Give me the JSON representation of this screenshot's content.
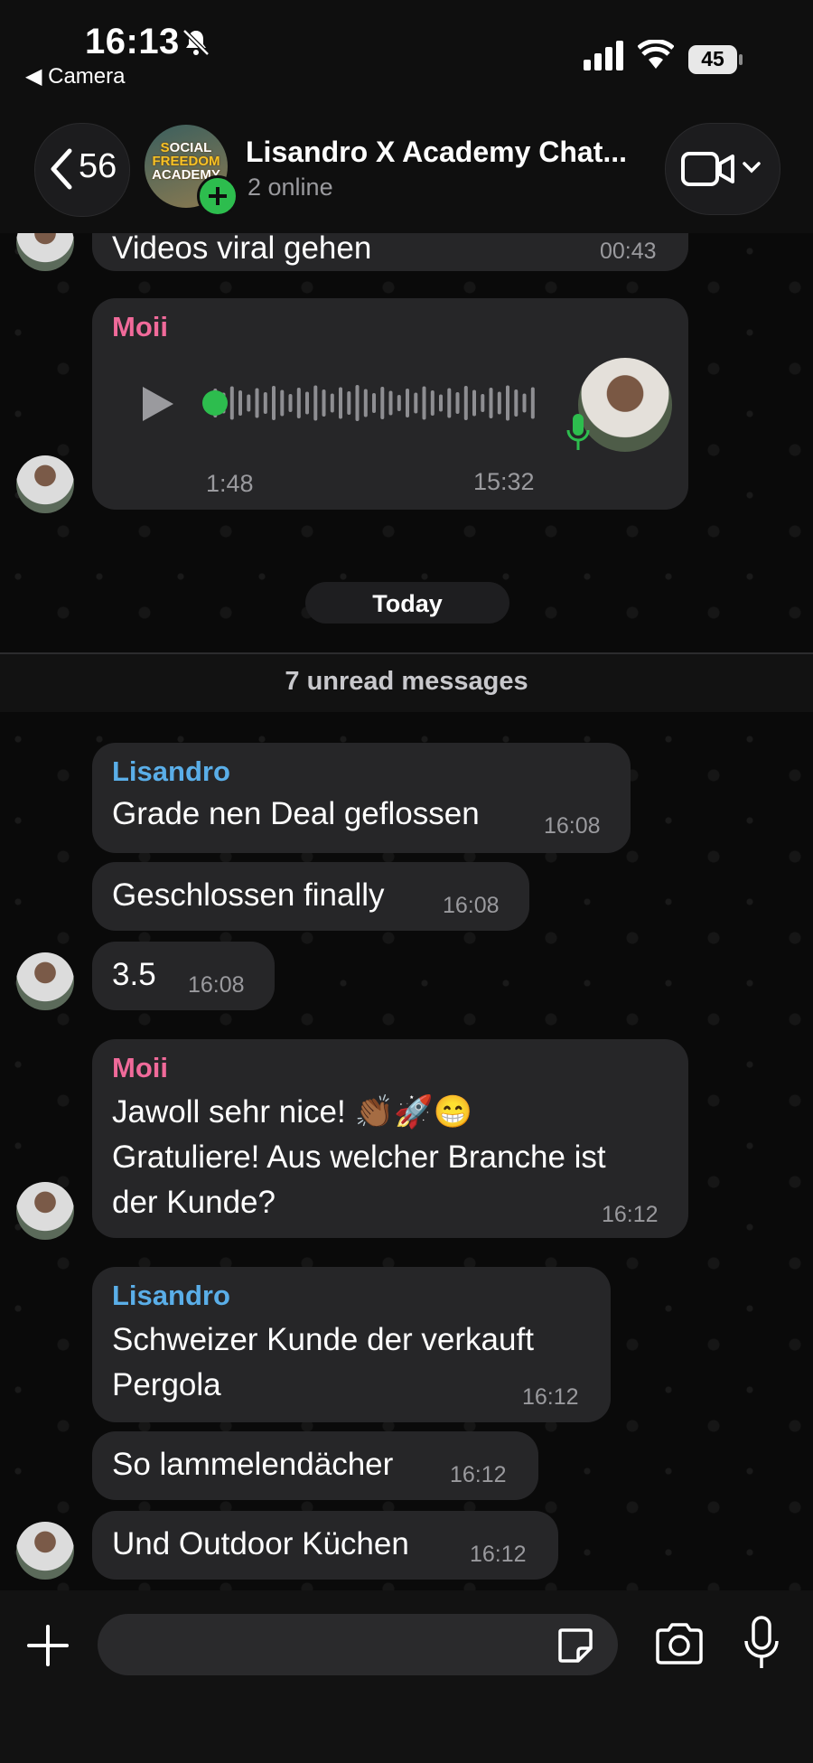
{
  "status_bar": {
    "time": "16:13",
    "back_app_label": "◀ Camera",
    "battery": "45",
    "icons": [
      "bell-slash-icon",
      "signal-icon",
      "wifi-icon",
      "battery-icon"
    ]
  },
  "header": {
    "back_count": "56",
    "avatar_text": [
      "S",
      "OCIAL",
      "FREEDOM",
      "ACADEMY"
    ],
    "title": "Lisandro X Academy Chat...",
    "subtitle": "2 online",
    "icons": [
      "chevron-left-icon",
      "video-camera-icon",
      "chevron-down-icon",
      "plus-badge-icon"
    ]
  },
  "chat": {
    "partial_message": {
      "text": "Videos viral gehen",
      "time": "00:43"
    },
    "voice_message": {
      "sender": "Moii",
      "duration": "1:48",
      "time": "15:32",
      "progress": 0.0,
      "icons": [
        "play-icon",
        "mic-icon"
      ]
    },
    "day_separator": "Today",
    "unread_label": "7 unread messages",
    "messages": [
      {
        "sender": "Lisandro",
        "lines": [
          "Grade nen Deal geflossen"
        ],
        "time": "16:08"
      },
      {
        "lines": [
          "Geschlossen finally"
        ],
        "time": "16:08"
      },
      {
        "lines": [
          "3.5"
        ],
        "time": "16:08"
      },
      {
        "sender": "Moii",
        "lines": [
          "Jawoll sehr nice! 👏🏾🚀😁",
          "Gratuliere! Aus welcher Branche ist",
          "der Kunde?"
        ],
        "time": "16:12"
      },
      {
        "sender": "Lisandro",
        "lines": [
          "Schweizer Kunde der verkauft",
          "Pergola"
        ],
        "time": "16:12"
      },
      {
        "lines": [
          "So lammelendächer"
        ],
        "time": "16:12"
      },
      {
        "lines": [
          "Und Outdoor Küchen"
        ],
        "time": "16:12"
      }
    ]
  },
  "input_bar": {
    "placeholder": "",
    "icons": [
      "plus-icon",
      "sticker-icon",
      "camera-icon",
      "microphone-icon"
    ]
  },
  "colors": {
    "moii": "#f06a9a",
    "lisandro": "#5aaee8",
    "accent_green": "#2dbd4e",
    "bubble": "#262628"
  }
}
